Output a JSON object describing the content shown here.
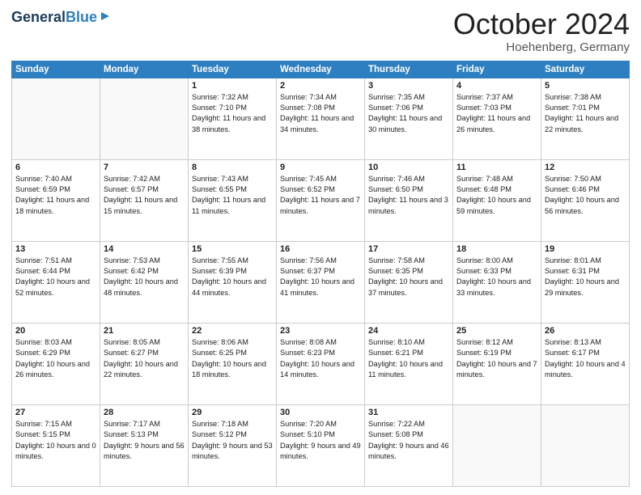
{
  "logo": {
    "general": "General",
    "blue": "Blue"
  },
  "title": "October 2024",
  "location": "Hoehenberg, Germany",
  "days_header": [
    "Sunday",
    "Monday",
    "Tuesday",
    "Wednesday",
    "Thursday",
    "Friday",
    "Saturday"
  ],
  "weeks": [
    [
      {
        "day": "",
        "info": ""
      },
      {
        "day": "",
        "info": ""
      },
      {
        "day": "1",
        "info": "Sunrise: 7:32 AM\nSunset: 7:10 PM\nDaylight: 11 hours and 38 minutes."
      },
      {
        "day": "2",
        "info": "Sunrise: 7:34 AM\nSunset: 7:08 PM\nDaylight: 11 hours and 34 minutes."
      },
      {
        "day": "3",
        "info": "Sunrise: 7:35 AM\nSunset: 7:06 PM\nDaylight: 11 hours and 30 minutes."
      },
      {
        "day": "4",
        "info": "Sunrise: 7:37 AM\nSunset: 7:03 PM\nDaylight: 11 hours and 26 minutes."
      },
      {
        "day": "5",
        "info": "Sunrise: 7:38 AM\nSunset: 7:01 PM\nDaylight: 11 hours and 22 minutes."
      }
    ],
    [
      {
        "day": "6",
        "info": "Sunrise: 7:40 AM\nSunset: 6:59 PM\nDaylight: 11 hours and 18 minutes."
      },
      {
        "day": "7",
        "info": "Sunrise: 7:42 AM\nSunset: 6:57 PM\nDaylight: 11 hours and 15 minutes."
      },
      {
        "day": "8",
        "info": "Sunrise: 7:43 AM\nSunset: 6:55 PM\nDaylight: 11 hours and 11 minutes."
      },
      {
        "day": "9",
        "info": "Sunrise: 7:45 AM\nSunset: 6:52 PM\nDaylight: 11 hours and 7 minutes."
      },
      {
        "day": "10",
        "info": "Sunrise: 7:46 AM\nSunset: 6:50 PM\nDaylight: 11 hours and 3 minutes."
      },
      {
        "day": "11",
        "info": "Sunrise: 7:48 AM\nSunset: 6:48 PM\nDaylight: 10 hours and 59 minutes."
      },
      {
        "day": "12",
        "info": "Sunrise: 7:50 AM\nSunset: 6:46 PM\nDaylight: 10 hours and 56 minutes."
      }
    ],
    [
      {
        "day": "13",
        "info": "Sunrise: 7:51 AM\nSunset: 6:44 PM\nDaylight: 10 hours and 52 minutes."
      },
      {
        "day": "14",
        "info": "Sunrise: 7:53 AM\nSunset: 6:42 PM\nDaylight: 10 hours and 48 minutes."
      },
      {
        "day": "15",
        "info": "Sunrise: 7:55 AM\nSunset: 6:39 PM\nDaylight: 10 hours and 44 minutes."
      },
      {
        "day": "16",
        "info": "Sunrise: 7:56 AM\nSunset: 6:37 PM\nDaylight: 10 hours and 41 minutes."
      },
      {
        "day": "17",
        "info": "Sunrise: 7:58 AM\nSunset: 6:35 PM\nDaylight: 10 hours and 37 minutes."
      },
      {
        "day": "18",
        "info": "Sunrise: 8:00 AM\nSunset: 6:33 PM\nDaylight: 10 hours and 33 minutes."
      },
      {
        "day": "19",
        "info": "Sunrise: 8:01 AM\nSunset: 6:31 PM\nDaylight: 10 hours and 29 minutes."
      }
    ],
    [
      {
        "day": "20",
        "info": "Sunrise: 8:03 AM\nSunset: 6:29 PM\nDaylight: 10 hours and 26 minutes."
      },
      {
        "day": "21",
        "info": "Sunrise: 8:05 AM\nSunset: 6:27 PM\nDaylight: 10 hours and 22 minutes."
      },
      {
        "day": "22",
        "info": "Sunrise: 8:06 AM\nSunset: 6:25 PM\nDaylight: 10 hours and 18 minutes."
      },
      {
        "day": "23",
        "info": "Sunrise: 8:08 AM\nSunset: 6:23 PM\nDaylight: 10 hours and 14 minutes."
      },
      {
        "day": "24",
        "info": "Sunrise: 8:10 AM\nSunset: 6:21 PM\nDaylight: 10 hours and 11 minutes."
      },
      {
        "day": "25",
        "info": "Sunrise: 8:12 AM\nSunset: 6:19 PM\nDaylight: 10 hours and 7 minutes."
      },
      {
        "day": "26",
        "info": "Sunrise: 8:13 AM\nSunset: 6:17 PM\nDaylight: 10 hours and 4 minutes."
      }
    ],
    [
      {
        "day": "27",
        "info": "Sunrise: 7:15 AM\nSunset: 5:15 PM\nDaylight: 10 hours and 0 minutes."
      },
      {
        "day": "28",
        "info": "Sunrise: 7:17 AM\nSunset: 5:13 PM\nDaylight: 9 hours and 56 minutes."
      },
      {
        "day": "29",
        "info": "Sunrise: 7:18 AM\nSunset: 5:12 PM\nDaylight: 9 hours and 53 minutes."
      },
      {
        "day": "30",
        "info": "Sunrise: 7:20 AM\nSunset: 5:10 PM\nDaylight: 9 hours and 49 minutes."
      },
      {
        "day": "31",
        "info": "Sunrise: 7:22 AM\nSunset: 5:08 PM\nDaylight: 9 hours and 46 minutes."
      },
      {
        "day": "",
        "info": ""
      },
      {
        "day": "",
        "info": ""
      }
    ]
  ]
}
